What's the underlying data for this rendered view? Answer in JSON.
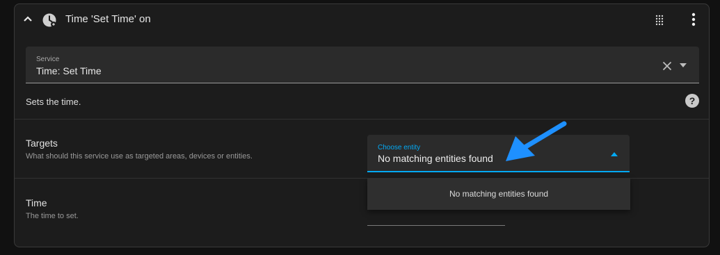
{
  "header": {
    "title": "Time 'Set Time' on"
  },
  "service": {
    "label": "Service",
    "value": "Time: Set Time"
  },
  "description": "Sets the time.",
  "targets": {
    "title": "Targets",
    "subtitle": "What should this service use as targeted areas, devices or entities.",
    "entity_picker": {
      "label": "Choose entity",
      "value": "No matching entities found",
      "menu_item": "No matching entities found"
    }
  },
  "time": {
    "title": "Time",
    "subtitle": "The time to set."
  },
  "colors": {
    "accent": "#03a9f4",
    "callout_arrow": "#1e90ff",
    "card_background": "#1c1c1c"
  },
  "icons": [
    "chevron-up-icon",
    "clock-icon",
    "drag-handle-icon",
    "overflow-menu-icon",
    "clear-icon",
    "dropdown-arrow-icon",
    "help-icon"
  ]
}
